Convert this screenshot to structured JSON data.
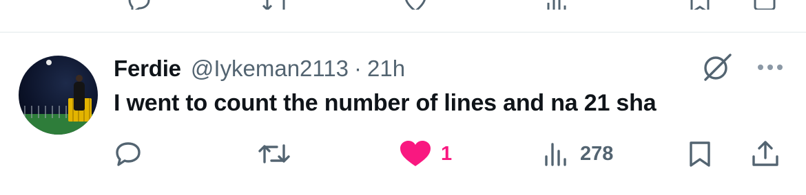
{
  "tweet": {
    "display_name": "Ferdie",
    "handle": "@Iykeman2113",
    "separator": "·",
    "time": "21h",
    "text": "I went to count the number of lines and na 21 sha",
    "likes": "1",
    "views": "278"
  },
  "colors": {
    "text_primary": "#0f1419",
    "text_secondary": "#536471",
    "like": "#f91880",
    "divider": "#eff3f4"
  },
  "icons": {
    "reply": "reply-icon",
    "retweet": "retweet-icon",
    "like": "heart-icon",
    "views": "views-icon",
    "bookmark": "bookmark-icon",
    "share": "share-icon",
    "more": "more-icon",
    "verified": "verified-slash-icon"
  }
}
